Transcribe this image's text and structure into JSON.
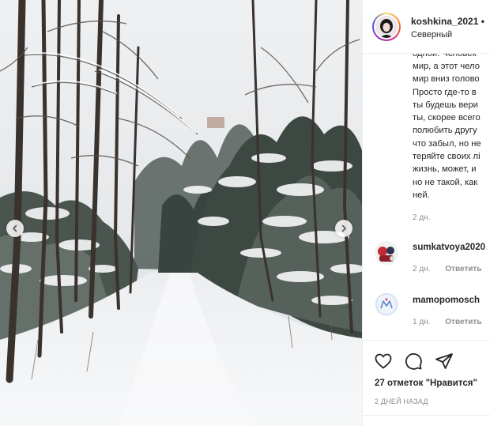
{
  "post": {
    "username": "koshkina_2021",
    "separator": "•",
    "location": "Северный",
    "caption_lines": [
      "одной. Человек",
      "мир, а этот чело",
      "мир вниз голово",
      "Просто где-то в",
      "ты будешь вери",
      "ты, скорее всего",
      "полюбить другу",
      "что забыл, но не",
      "теряйте своих лі",
      "жизнь, может, и",
      "но не такой, как",
      "ней."
    ],
    "caption_time": "2 дн."
  },
  "comments": [
    {
      "username": "sumkatvoya2020",
      "time": "2 дн.",
      "reply": "Ответить"
    },
    {
      "username": "mamopomosch",
      "time": "1 дн.",
      "reply": "Ответить"
    }
  ],
  "actions": {
    "likes_text": "27 отметок \"Нравится\"",
    "date_text": "2 ДНЕЙ НАЗАД"
  },
  "icons": {
    "like": "heart-icon",
    "comment": "comment-bubble-icon",
    "share": "paper-plane-icon",
    "prev": "chevron-left-icon",
    "next": "chevron-right-icon"
  },
  "colors": {
    "text": "#262626",
    "muted": "#8e8e8e",
    "border": "#efefef"
  }
}
